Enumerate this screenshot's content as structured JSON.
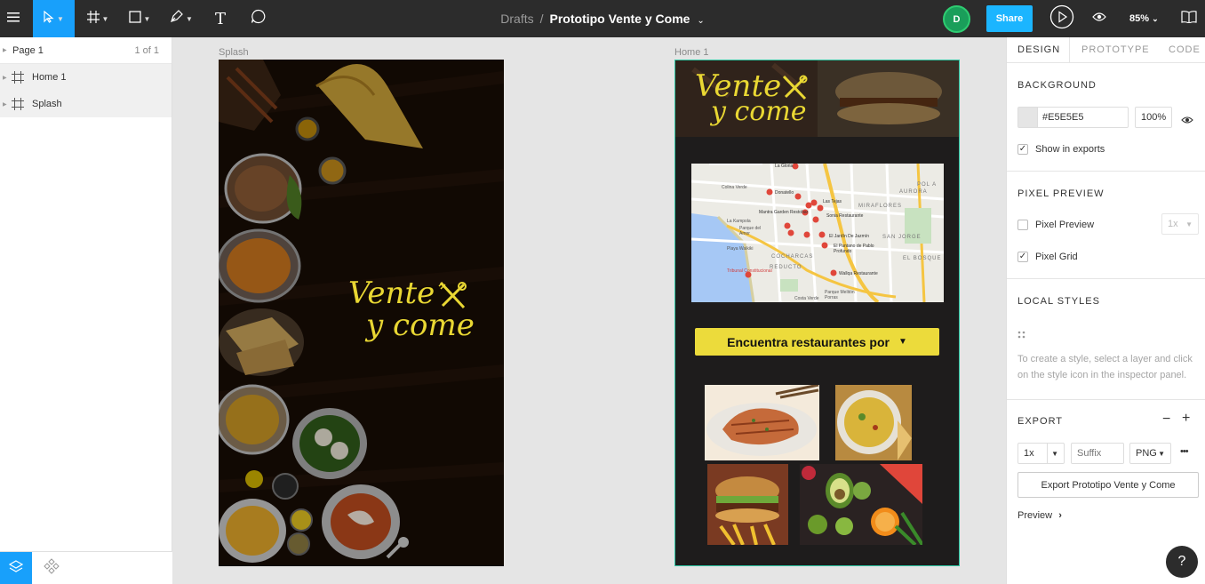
{
  "toolbar": {
    "menu_icon": "hamburger-icon",
    "tools": [
      "move-tool",
      "frame-tool",
      "shape-tool",
      "pen-tool",
      "text-tool",
      "comment-tool"
    ],
    "text_tool_glyph": "T",
    "breadcrumb_drafts": "Drafts",
    "breadcrumb_sep": "/",
    "file_name": "Prototipo Vente y Come",
    "file_caret": "⌄",
    "avatar_initial": "D",
    "share_label": "Share",
    "zoom_label": "85%",
    "zoom_caret": "⌄",
    "accent": "#1bb5ff"
  },
  "layers": {
    "page_name": "Page 1",
    "page_count": "1 of 1",
    "items": [
      {
        "label": "Home 1"
      },
      {
        "label": "Splash"
      }
    ]
  },
  "canvas": {
    "background": "#E5E5E5",
    "splash_label": "Splash",
    "home_label": "Home 1",
    "logo_line1": "Vente",
    "logo_line2": "y come",
    "logo_color": "#e9d733",
    "find_button": "Encuentra restaurantes por",
    "find_caret": "▼",
    "map": {
      "places": [
        "La Gloria",
        "Donatello",
        "Mantra Garden Restobar",
        "Las Tejas",
        "Sonia Restaurante",
        "El Jardín De Jazmín",
        "El Pantano de Pablo Profundo",
        "Wallqa Restaurante"
      ],
      "districts": [
        "MIRAFLORES",
        "SAN JORGE",
        "AURORA",
        "COCHARCAS",
        "REDUCTO",
        "EL BOSQUE",
        "POL A"
      ],
      "misc": [
        "La Kampola",
        "Parque del Amor",
        "Playa Waikiki",
        "Costa Verde",
        "Parque Melitón Porras",
        "Colina Verde",
        "Tribunal Constitucional"
      ]
    }
  },
  "inspector": {
    "tabs": [
      "DESIGN",
      "PROTOTYPE",
      "CODE"
    ],
    "background_heading": "BACKGROUND",
    "bg_hex": "#E5E5E5",
    "bg_opacity": "100%",
    "show_in_exports": "Show in exports",
    "pixel_preview_heading": "PIXEL PREVIEW",
    "pixel_preview_label": "Pixel Preview",
    "pixel_preview_scale": "1x",
    "pixel_grid_label": "Pixel Grid",
    "local_styles_heading": "LOCAL STYLES",
    "local_styles_hint": "To create a style, select a layer and click on the style icon in the inspector panel.",
    "export_heading": "EXPORT",
    "export_minus": "−",
    "export_plus": "+",
    "export_scale": "1x",
    "export_suffix_placeholder": "Suffix",
    "export_format": "PNG",
    "export_more": "•••",
    "export_button": "Export Prototipo Vente y Come",
    "preview_label": "Preview",
    "preview_caret": "›",
    "help": "?"
  }
}
